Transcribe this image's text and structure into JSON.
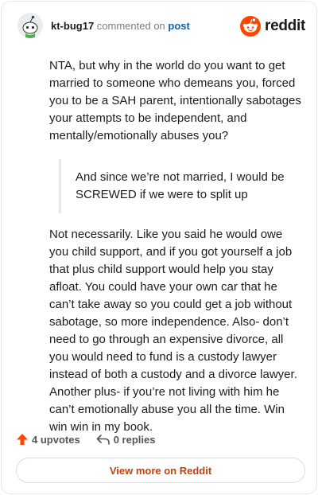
{
  "comment": {
    "username": "kt-bug17",
    "action_text": "commented on",
    "post_link": "post",
    "paragraph_1": "NTA, but why in the world do you want to get married to someone who demeans you, forced you to be a SAH parent, intentionally sabotages your attempts to be independent, and mentally/emotionally abuses you?",
    "quote": "And since we’re not married, I would be SCREWED if we were to split up",
    "paragraph_2": "Not necessarily. Like you said he would owe you child support, and if you got yourself a job that plus child support would help you stay afloat. You could have your own car that he can’t take away so you could get a job without sabotage, so more independence. Also- don’t need to go through an expensive divorce, all you would need to fund is a custody lawyer instead of both a custody and a divorce lawyer. Another plus- if you’re not living with him he can’t emotionally abuse you all the time. Win win win in my book."
  },
  "brand": {
    "name": "reddit",
    "icon": "reddit-logo-icon",
    "accent": "#ff4500"
  },
  "footer": {
    "upvotes": "4 upvotes",
    "replies": "0 replies",
    "view_more": "View more on Reddit",
    "upvote_icon": "upvote-arrow-icon",
    "reply_icon": "reply-arrow-icon"
  },
  "colors": {
    "upvote": "#ff4500",
    "link": "#0f5fa8",
    "view_more": "#c2410c"
  }
}
